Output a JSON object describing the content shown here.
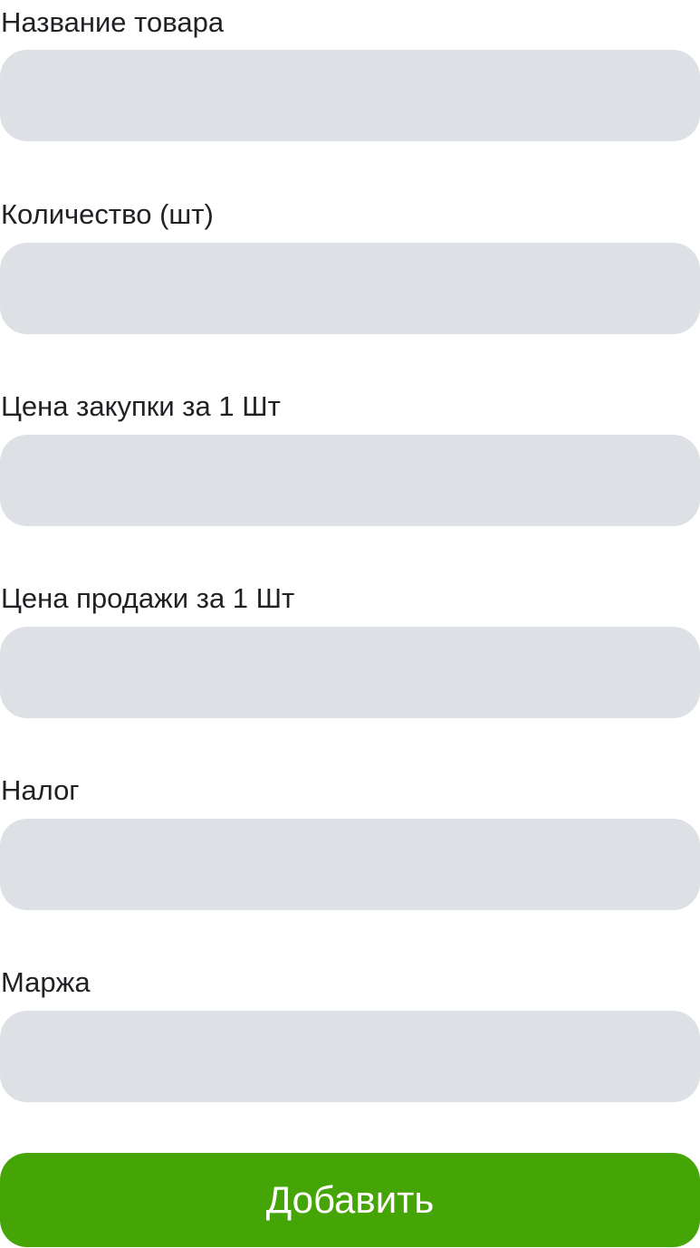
{
  "form": {
    "fields": [
      {
        "label": "Название товара",
        "value": "",
        "placeholder": ""
      },
      {
        "label": "Количество (шт)",
        "value": "",
        "placeholder": ""
      },
      {
        "label": "Цена закупки за 1 Шт",
        "value": "",
        "placeholder": ""
      },
      {
        "label": "Цена продажи за 1 Шт",
        "value": "",
        "placeholder": ""
      },
      {
        "label": "Налог",
        "value": "",
        "placeholder": ""
      },
      {
        "label": "Маржа",
        "value": "",
        "placeholder": ""
      }
    ],
    "submit_label": "Добавить"
  },
  "colors": {
    "input_background": "#dde1e5",
    "button_background": "#46a506",
    "button_text": "#ffffff",
    "label_text": "#1f2125"
  }
}
